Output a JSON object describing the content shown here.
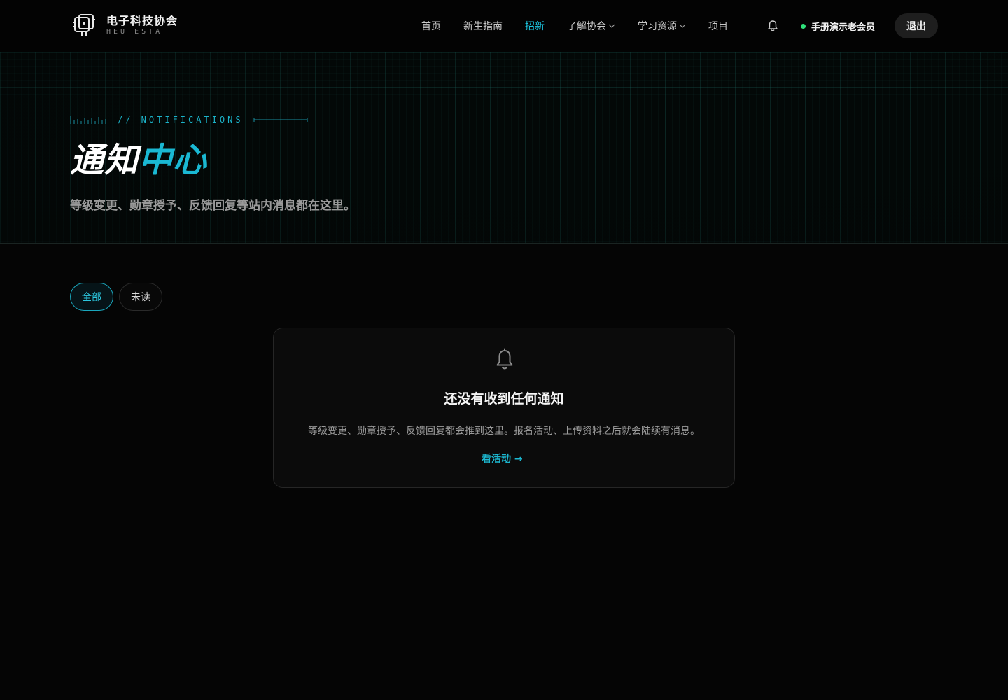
{
  "brand": {
    "name": "电子科技协会",
    "sub": "HEU ESTA"
  },
  "nav": [
    {
      "label": "首页",
      "active": false,
      "dropdown": false
    },
    {
      "label": "新生指南",
      "active": false,
      "dropdown": false
    },
    {
      "label": "招新",
      "active": true,
      "dropdown": false
    },
    {
      "label": "了解协会",
      "active": false,
      "dropdown": true
    },
    {
      "label": "学习资源",
      "active": false,
      "dropdown": true
    },
    {
      "label": "项目",
      "active": false,
      "dropdown": false
    }
  ],
  "header": {
    "bell_icon": "bell-icon",
    "user_name": "手册演示老会员",
    "user_status_color": "#2ee07a",
    "logout_label": "退出"
  },
  "hero": {
    "eyebrow": "// NOTIFICATIONS",
    "title_part1": "通知",
    "title_part2": "中心",
    "subtitle": "等级变更、勋章授予、反馈回复等站内消息都在这里。"
  },
  "tabs": [
    {
      "label": "全部",
      "active": true
    },
    {
      "label": "未读",
      "active": false
    }
  ],
  "empty_state": {
    "icon": "bell-icon",
    "title": "还没有收到任何通知",
    "description": "等级变更、勋章授予、反馈回复都会推到这里。报名活动、上传资料之后就会陆续有消息。",
    "link_label": "看活动 →"
  },
  "colors": {
    "accent": "#1cb9d2",
    "background": "#050505",
    "card": "#0b0b0b"
  }
}
